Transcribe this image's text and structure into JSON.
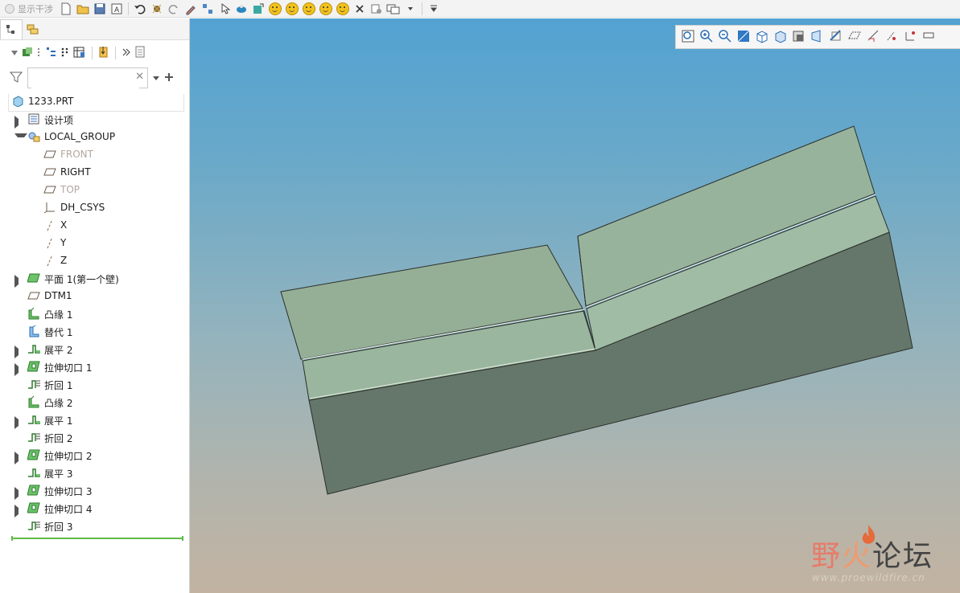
{
  "toolbar": {
    "interference_label": "显示干涉"
  },
  "search": {
    "placeholder": "",
    "value": ""
  },
  "model_tree": [
    {
      "label": "1233.PRT",
      "icon": "part-icon",
      "twist": "none",
      "indent": 0,
      "dim": false
    },
    {
      "label": "设计项",
      "icon": "design-items-icon",
      "twist": "right",
      "indent": 1,
      "dim": false
    },
    {
      "label": "LOCAL_GROUP",
      "icon": "group-icon",
      "twist": "down",
      "indent": 1,
      "dim": false
    },
    {
      "label": "FRONT",
      "icon": "datum-plane-icon",
      "twist": "none",
      "indent": 2,
      "dim": true
    },
    {
      "label": "RIGHT",
      "icon": "datum-plane-icon",
      "twist": "none",
      "indent": 2,
      "dim": false
    },
    {
      "label": "TOP",
      "icon": "datum-plane-icon",
      "twist": "none",
      "indent": 2,
      "dim": true
    },
    {
      "label": "DH_CSYS",
      "icon": "csys-icon",
      "twist": "none",
      "indent": 2,
      "dim": false
    },
    {
      "label": "X",
      "icon": "datum-axis-icon",
      "twist": "none",
      "indent": 2,
      "dim": false
    },
    {
      "label": "Y",
      "icon": "datum-axis-icon",
      "twist": "none",
      "indent": 2,
      "dim": false
    },
    {
      "label": "Z",
      "icon": "datum-axis-icon",
      "twist": "none",
      "indent": 2,
      "dim": false
    },
    {
      "label": "平面 1(第一个壁)",
      "icon": "first-wall-icon",
      "twist": "right",
      "indent": 1,
      "dim": false
    },
    {
      "label": "DTM1",
      "icon": "datum-plane-icon",
      "twist": "none",
      "indent": 1,
      "dim": false
    },
    {
      "label": "凸缘 1",
      "icon": "flange-icon",
      "twist": "none",
      "indent": 1,
      "dim": false
    },
    {
      "label": "替代 1",
      "icon": "substitute-icon",
      "twist": "none",
      "indent": 1,
      "dim": false
    },
    {
      "label": "展平 2",
      "icon": "unbend-icon",
      "twist": "right",
      "indent": 1,
      "dim": false
    },
    {
      "label": "拉伸切口 1",
      "icon": "extrude-cut-icon",
      "twist": "right",
      "indent": 1,
      "dim": false
    },
    {
      "label": "折回 1",
      "icon": "bend-back-icon",
      "twist": "none",
      "indent": 1,
      "dim": false
    },
    {
      "label": "凸缘 2",
      "icon": "flange-icon",
      "twist": "none",
      "indent": 1,
      "dim": false
    },
    {
      "label": "展平 1",
      "icon": "unbend-icon",
      "twist": "right",
      "indent": 1,
      "dim": false
    },
    {
      "label": "折回 2",
      "icon": "bend-back-icon",
      "twist": "none",
      "indent": 1,
      "dim": false
    },
    {
      "label": "拉伸切口 2",
      "icon": "extrude-cut-icon",
      "twist": "right",
      "indent": 1,
      "dim": false
    },
    {
      "label": "展平 3",
      "icon": "unbend-icon",
      "twist": "none",
      "indent": 1,
      "dim": false
    },
    {
      "label": "拉伸切口 3",
      "icon": "extrude-cut-icon",
      "twist": "right",
      "indent": 1,
      "dim": false
    },
    {
      "label": "拉伸切口 4",
      "icon": "extrude-cut-icon",
      "twist": "right",
      "indent": 1,
      "dim": false
    },
    {
      "label": "折回 3",
      "icon": "bend-back-icon",
      "twist": "none",
      "indent": 1,
      "dim": false
    }
  ],
  "watermark": {
    "title_part1": "野",
    "title_part2": "火",
    "title_part3": "论坛",
    "url": "www.proewildfire.cn"
  },
  "colors": {
    "viewport_top": "#53a2d2",
    "viewport_bottom": "#c2b3a1",
    "model_top_face": "#9cb8a0",
    "model_side_face": "#65776a",
    "insert_marker": "#5fba46"
  }
}
